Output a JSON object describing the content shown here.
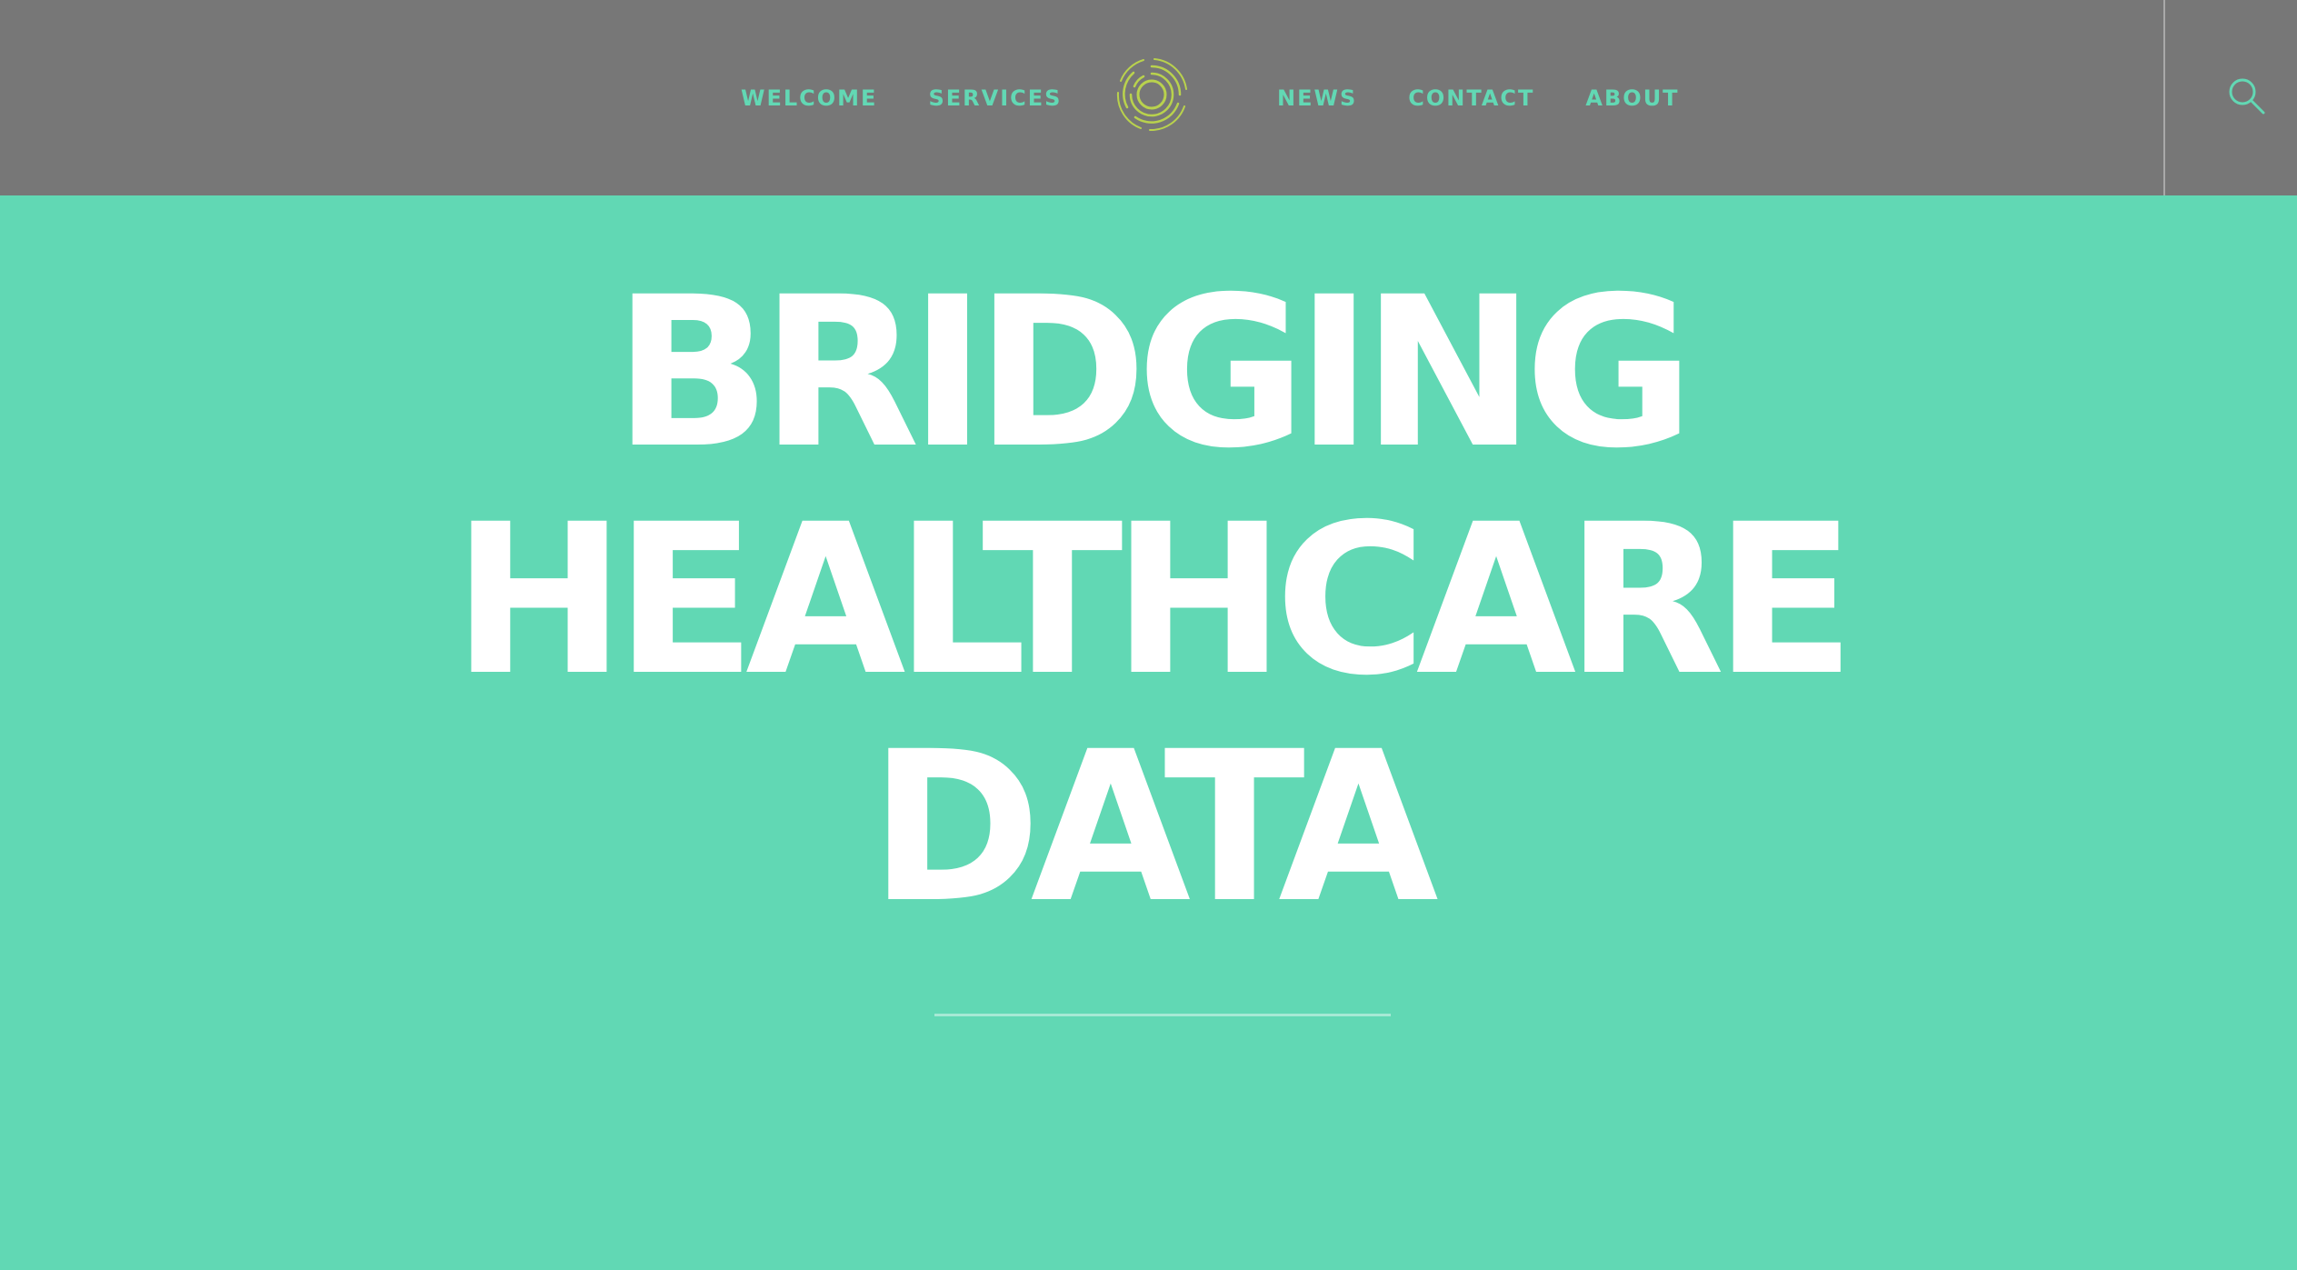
{
  "header": {
    "nav_left": [
      "WELCOME",
      "SERVICES"
    ],
    "nav_right": [
      "NEWS",
      "CONTACT",
      "ABOUT"
    ],
    "logo_icon": "concentric-rings-logo",
    "search_icon": "search-icon"
  },
  "hero": {
    "headline_lines": [
      "BRIDGING",
      "HEALTHCARE",
      "DATA"
    ]
  },
  "colors": {
    "header_bg": "#777777",
    "hero_bg": "#61d8b4",
    "accent": "#62d8b4",
    "logo": "#b9d24d",
    "headline": "#ffffff"
  }
}
